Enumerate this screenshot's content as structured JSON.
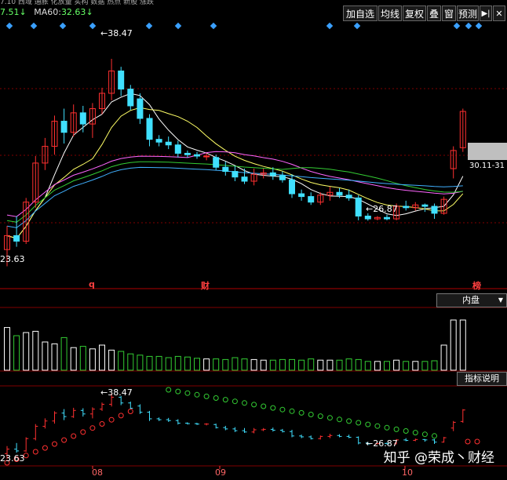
{
  "ticker_strip": "7.10  西域  通胀  化放量  实构  数据  热点  新股  涨跌",
  "ma_legend": {
    "ma_prev": "7.51",
    "ma60_label": "MA60:",
    "ma60_value": "32.63"
  },
  "toolbar": {
    "buttons": [
      "加自选",
      "均线",
      "复权",
      "叠",
      "窗",
      "预测"
    ],
    "nav": "▶|",
    "close": "✕"
  },
  "main_chart": {
    "high_label": "38.47",
    "low_label": "26.87",
    "left_low_label": "23.63",
    "range_label": "30.11-31",
    "event_q": "q",
    "event_cai": "财",
    "event_bang": "榜"
  },
  "volume_panel": {
    "dropdown": "内盘",
    "dropdown_arrow": "▼"
  },
  "indicator_panel": {
    "help_button": "指标说明",
    "high_label": "38.47",
    "low_label": "26.87",
    "left_low_label": "23.63"
  },
  "x_axis": {
    "labels": [
      "08",
      "09",
      "10"
    ]
  },
  "watermark": "知乎 @荣成丶财经",
  "colors": {
    "up": "#ff3030",
    "down": "#40e0ff",
    "vol_up": "#ffffff",
    "vol_down": "#33cc33",
    "ma5": "#ffffff",
    "ma10": "#ffff66",
    "ma20": "#ff66ff",
    "ma30": "#33cc33",
    "ma60": "#40b0ff",
    "sar_circle_up": "#ff3030",
    "sar_circle_dn": "#33cc33",
    "marker": "#3aa0ff",
    "grid": "#800000"
  },
  "chart_data": {
    "type": "candlestick",
    "price_range": [
      22,
      41
    ],
    "candles": [
      {
        "o": 24.8,
        "h": 26.5,
        "l": 23.6,
        "c": 25.8
      },
      {
        "o": 25.8,
        "h": 27.2,
        "l": 25.0,
        "c": 25.4
      },
      {
        "o": 25.4,
        "h": 28.5,
        "l": 25.2,
        "c": 28.2
      },
      {
        "o": 28.2,
        "h": 31.5,
        "l": 27.8,
        "c": 31.0
      },
      {
        "o": 31.0,
        "h": 32.8,
        "l": 30.5,
        "c": 32.2
      },
      {
        "o": 32.2,
        "h": 34.4,
        "l": 31.6,
        "c": 34.0
      },
      {
        "o": 34.0,
        "h": 34.9,
        "l": 32.4,
        "c": 33.2
      },
      {
        "o": 33.2,
        "h": 35.2,
        "l": 32.9,
        "c": 34.6
      },
      {
        "o": 34.6,
        "h": 35.1,
        "l": 33.2,
        "c": 33.8
      },
      {
        "o": 33.8,
        "h": 35.3,
        "l": 32.8,
        "c": 34.9
      },
      {
        "o": 34.9,
        "h": 36.4,
        "l": 34.5,
        "c": 36.0
      },
      {
        "o": 36.0,
        "h": 38.47,
        "l": 35.5,
        "c": 37.6
      },
      {
        "o": 37.6,
        "h": 37.9,
        "l": 35.8,
        "c": 36.3
      },
      {
        "o": 36.3,
        "h": 36.6,
        "l": 34.8,
        "c": 35.1
      },
      {
        "o": 35.6,
        "h": 36.0,
        "l": 33.8,
        "c": 34.2
      },
      {
        "o": 34.2,
        "h": 34.5,
        "l": 32.2,
        "c": 32.7
      },
      {
        "o": 32.7,
        "h": 33.0,
        "l": 32.2,
        "c": 32.5
      },
      {
        "o": 32.5,
        "h": 32.9,
        "l": 32.0,
        "c": 32.3
      },
      {
        "o": 32.3,
        "h": 32.6,
        "l": 31.4,
        "c": 31.7
      },
      {
        "o": 31.7,
        "h": 31.9,
        "l": 31.4,
        "c": 31.6
      },
      {
        "o": 31.6,
        "h": 31.8,
        "l": 31.3,
        "c": 31.5
      },
      {
        "o": 31.5,
        "h": 31.7,
        "l": 31.2,
        "c": 31.5
      },
      {
        "o": 31.4,
        "h": 31.6,
        "l": 30.5,
        "c": 30.7
      },
      {
        "o": 30.7,
        "h": 31.1,
        "l": 30.1,
        "c": 30.4
      },
      {
        "o": 30.4,
        "h": 30.8,
        "l": 29.7,
        "c": 30.0
      },
      {
        "o": 30.0,
        "h": 30.6,
        "l": 29.5,
        "c": 29.7
      },
      {
        "o": 29.7,
        "h": 30.6,
        "l": 29.4,
        "c": 30.2
      },
      {
        "o": 30.2,
        "h": 30.6,
        "l": 29.9,
        "c": 30.3
      },
      {
        "o": 30.3,
        "h": 30.7,
        "l": 29.8,
        "c": 30.1
      },
      {
        "o": 30.1,
        "h": 30.4,
        "l": 29.6,
        "c": 29.8
      },
      {
        "o": 29.8,
        "h": 30.2,
        "l": 28.5,
        "c": 28.8
      },
      {
        "o": 28.8,
        "h": 29.1,
        "l": 28.3,
        "c": 28.6
      },
      {
        "o": 28.6,
        "h": 28.9,
        "l": 28.0,
        "c": 28.2
      },
      {
        "o": 28.2,
        "h": 28.9,
        "l": 28.0,
        "c": 28.7
      },
      {
        "o": 28.7,
        "h": 29.3,
        "l": 28.3,
        "c": 28.9
      },
      {
        "o": 28.9,
        "h": 29.2,
        "l": 28.5,
        "c": 28.7
      },
      {
        "o": 28.7,
        "h": 29.1,
        "l": 28.3,
        "c": 28.5
      },
      {
        "o": 28.5,
        "h": 28.7,
        "l": 26.9,
        "c": 27.2
      },
      {
        "o": 27.2,
        "h": 27.4,
        "l": 26.87,
        "c": 27.0
      },
      {
        "o": 27.0,
        "h": 27.2,
        "l": 26.9,
        "c": 27.1
      },
      {
        "o": 27.1,
        "h": 27.3,
        "l": 26.9,
        "c": 27.0
      },
      {
        "o": 27.0,
        "h": 28.1,
        "l": 26.9,
        "c": 27.9
      },
      {
        "o": 27.9,
        "h": 28.3,
        "l": 27.6,
        "c": 27.8
      },
      {
        "o": 27.8,
        "h": 28.2,
        "l": 27.6,
        "c": 28.0
      },
      {
        "o": 28.0,
        "h": 28.1,
        "l": 27.5,
        "c": 27.9
      },
      {
        "o": 27.9,
        "h": 28.1,
        "l": 27.0,
        "c": 27.4
      },
      {
        "o": 27.4,
        "h": 28.6,
        "l": 27.3,
        "c": 28.4
      },
      {
        "o": 30.6,
        "h": 32.2,
        "l": 29.9,
        "c": 31.9
      },
      {
        "o": 32.1,
        "h": 34.9,
        "l": 31.8,
        "c": 34.7
      }
    ],
    "volumes": [
      0.68,
      0.55,
      0.6,
      0.62,
      0.45,
      0.42,
      0.52,
      0.36,
      0.38,
      0.34,
      0.4,
      0.32,
      0.3,
      0.26,
      0.24,
      0.22,
      0.22,
      0.2,
      0.22,
      0.21,
      0.19,
      0.18,
      0.18,
      0.17,
      0.2,
      0.18,
      0.17,
      0.16,
      0.16,
      0.17,
      0.17,
      0.16,
      0.18,
      0.16,
      0.16,
      0.16,
      0.18,
      0.17,
      0.14,
      0.14,
      0.14,
      0.16,
      0.14,
      0.14,
      0.14,
      0.15,
      0.4,
      0.8,
      0.8
    ]
  }
}
